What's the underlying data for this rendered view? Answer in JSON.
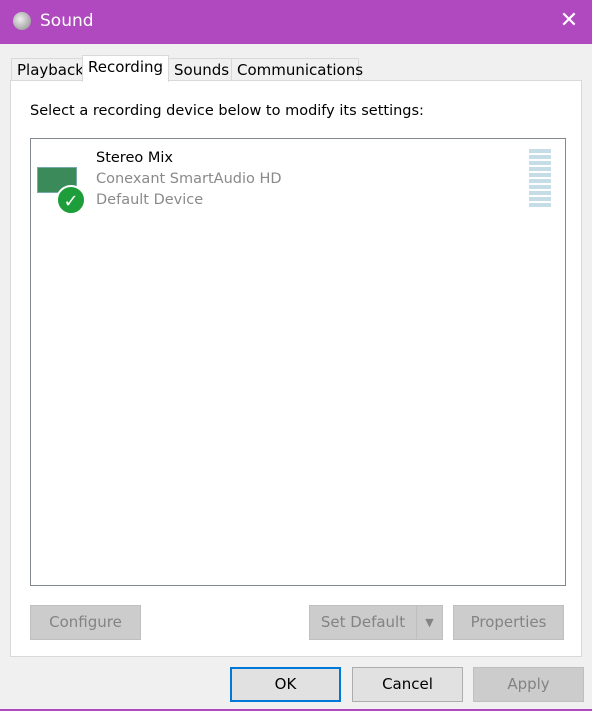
{
  "window": {
    "title": "Sound",
    "close_label": "✕",
    "accent": "#b048c0"
  },
  "tabs": [
    {
      "label": "Playback"
    },
    {
      "label": "Recording",
      "active": true
    },
    {
      "label": "Sounds"
    },
    {
      "label": "Communications"
    }
  ],
  "panel": {
    "instruction": "Select a recording device below to modify its settings:"
  },
  "devices": [
    {
      "name": "Stereo Mix",
      "driver": "Conexant SmartAudio HD",
      "status": "Default Device",
      "is_default": true,
      "level": 0
    }
  ],
  "buttons": {
    "configure": "Configure",
    "set_default": "Set Default",
    "properties": "Properties",
    "ok": "OK",
    "cancel": "Cancel",
    "apply": "Apply"
  }
}
